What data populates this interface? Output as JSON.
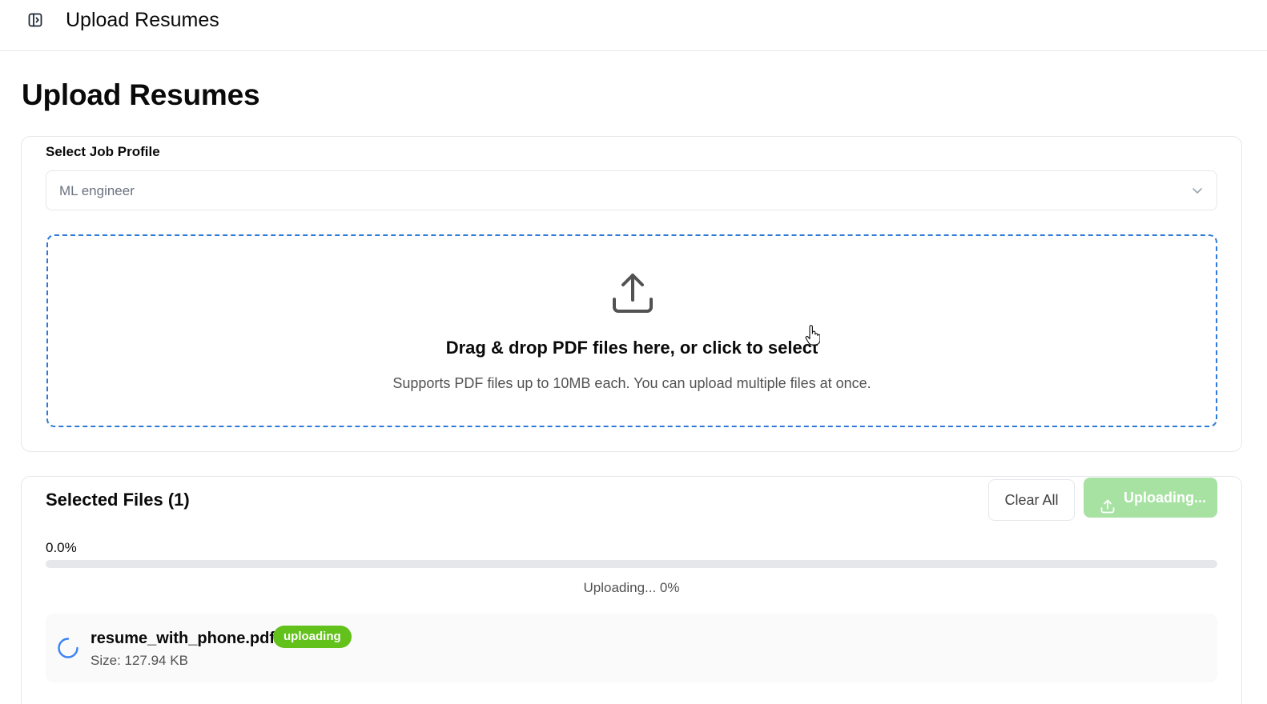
{
  "header": {
    "title": "Upload Resumes",
    "toggle_icon": "sidebar-toggle-icon"
  },
  "page": {
    "title": "Upload Resumes"
  },
  "job_profile": {
    "label": "Select Job Profile",
    "selected": "ML engineer"
  },
  "dropzone": {
    "icon": "upload-icon",
    "title": "Drag & drop PDF files here, or click to select",
    "subtitle": "Supports PDF files up to 10MB each. You can upload multiple files at once."
  },
  "selected_files": {
    "heading": "Selected Files (1)",
    "clear_label": "Clear All",
    "upload_label": "Uploading...",
    "progress_text": "0.0%",
    "progress_fraction": 0.0,
    "status_text": "Uploading... 0%",
    "files": [
      {
        "name": "resume_with_phone.pdf",
        "status": "uploading",
        "size": "Size: 127.94 KB"
      }
    ]
  },
  "colors": {
    "dropzone_border": "#2f7ad6",
    "upload_button_bg": "#a7e2a3",
    "badge_bg": "#62c11a",
    "spinner": "#3b82f6"
  }
}
